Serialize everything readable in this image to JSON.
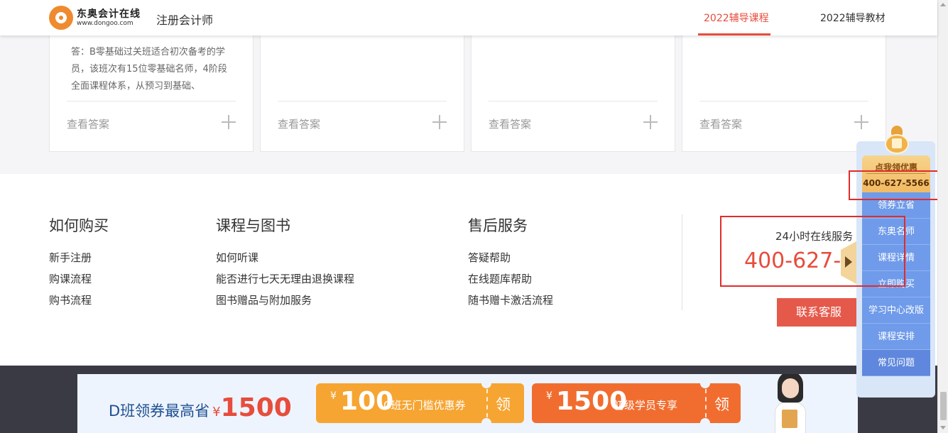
{
  "header": {
    "brand_name": "东奥会计在线",
    "brand_url": "www.dongoo.com",
    "site_title": "注册会计师",
    "nav": [
      "2022辅导课程",
      "2022辅导教材"
    ]
  },
  "faq": {
    "answer_1": "答：B零基础过关班适合初次备考的学员，该班次有15位零基础名师，4阶段全面课程体系，从预习到基础、",
    "view_answer": "查看答案"
  },
  "footer": {
    "columns": [
      {
        "title": "如何购买",
        "links": [
          "新手注册",
          "购课流程",
          "购书流程"
        ]
      },
      {
        "title": "课程与图书",
        "links": [
          "如何听课",
          "能否进行七天无理由退换课程",
          "图书赠品与附加服务"
        ]
      },
      {
        "title": "售后服务",
        "links": [
          "答疑帮助",
          "在线题库帮助",
          "随书赠卡激活流程"
        ]
      }
    ],
    "service": {
      "label": "24小时在线服务",
      "phone": "400-627-5566",
      "contact_button": "联系客服"
    }
  },
  "banner": {
    "lead": "D班领券最高省",
    "lead_yen": "¥",
    "lead_amount": "1500",
    "coupons": [
      {
        "yen": "¥",
        "amount": "100",
        "desc": "C班无门槛优惠券",
        "action": "领"
      },
      {
        "yen": "¥",
        "amount": "1500",
        "desc": "初级学员专享",
        "action": "领"
      }
    ]
  },
  "float_panel": {
    "promo_title": "点我领优惠",
    "promo_phone": "400-627-5566",
    "items": [
      "领券立省",
      "东奥名师",
      "课程详情",
      "立即购买",
      "学习中心改版",
      "课程安排",
      "常见问题"
    ]
  },
  "colors": {
    "accent_red": "#e74c3c",
    "panel_blue": "#6f9bea",
    "coupon_orange": "#f6a532",
    "coupon_deep_orange": "#f16d2f"
  }
}
